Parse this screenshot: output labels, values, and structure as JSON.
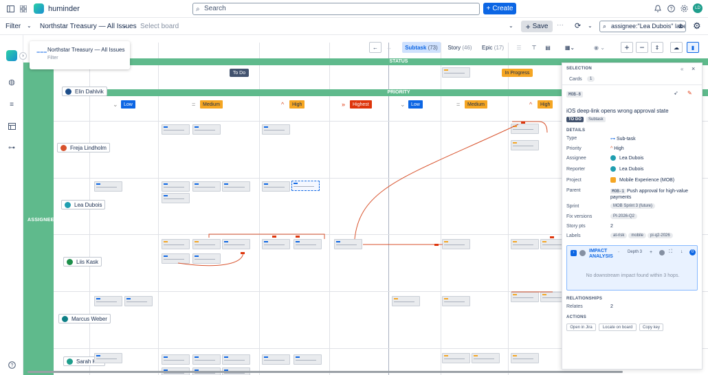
{
  "topbar": {
    "brand": "huminder",
    "search_placeholder": "Search",
    "create_label": "Create",
    "avatar_initials": "LD"
  },
  "filterbar": {
    "filter_label": "Filter",
    "board_name": "Northstar Treasury — All Issues",
    "select_board": "Select board",
    "save_label": "Save",
    "jql_value": "assignee:\"Lea Dubois\" labe"
  },
  "floatpanel": {
    "title": "Northstar Treasury — All Issues",
    "subtitle": "Filter"
  },
  "toolbar": {
    "tabs": [
      {
        "label": "Subtask",
        "count": "(73)"
      },
      {
        "label": "Story",
        "count": "(46)"
      },
      {
        "label": "Epic",
        "count": "(17)"
      }
    ]
  },
  "board": {
    "status_title": "STATUS",
    "priority_title": "PRIORITY",
    "assignee_title": "ASSIGNEE",
    "statuses": [
      "To Do",
      "In Progress"
    ],
    "priorities": [
      "Low",
      "Medium",
      "High",
      "Highest",
      "Low",
      "Medium",
      "High"
    ],
    "people": [
      {
        "name": "Elin Dahlvik",
        "color": "#1d4e89"
      },
      {
        "name": "Freja Lindholm",
        "color": "#d8522c"
      },
      {
        "name": "Lea Dubois",
        "color": "#1f9eb0"
      },
      {
        "name": "Liis Kask",
        "color": "#1d8f4a"
      },
      {
        "name": "Marcus Weber",
        "color": "#0e7f86"
      },
      {
        "name": "Sarah Kim",
        "color": "#1f9e8c"
      }
    ]
  },
  "selection": {
    "header": "SELECTION",
    "cards_label": "Cards",
    "cards_count": "1",
    "key": "MOB-8",
    "title": "iOS deep-link opens wrong approval state",
    "status": "TO DO",
    "type_badge": "Subtask",
    "details_header": "DETAILS",
    "fields": {
      "type_k": "Type",
      "type_v": "Sub-task",
      "priority_k": "Priority",
      "priority_v": "High",
      "assignee_k": "Assignee",
      "assignee_v": "Lea Dubois",
      "reporter_k": "Reporter",
      "reporter_v": "Lea Dubois",
      "project_k": "Project",
      "project_v": "Mobile Experience (MOB)",
      "parent_k": "Parent",
      "parent_key": "MOB-1",
      "parent_v": "Push approval for high-value payments",
      "sprint_k": "Sprint",
      "sprint_v": "MOB Sprint 3 (future)",
      "fix_k": "Fix versions",
      "fix_v": "PI-2026-Q2",
      "points_k": "Story pts",
      "points_v": "2",
      "labels_k": "Labels",
      "labels": [
        "at-risk",
        "mobile",
        "pi-q2-2026"
      ]
    },
    "impact": {
      "title": "IMPACT ANALYSIS",
      "depth": "Depth 3",
      "count": "0",
      "empty": "No downstream impact found within 3 hops."
    },
    "relationships_header": "RELATIONSHIPS",
    "relates_k": "Relates",
    "relates_v": "2",
    "actions_header": "ACTIONS",
    "actions": [
      "Open in Jira",
      "Locate on board",
      "Copy key"
    ]
  },
  "colors": {
    "band": "#5fba8c",
    "accent": "#0c66e4",
    "todo": "#42526e",
    "inprogress": "#f5a623",
    "highest": "#de350b",
    "low": "#0c66e4",
    "medium": "#f5a623",
    "high": "#f5a623"
  }
}
